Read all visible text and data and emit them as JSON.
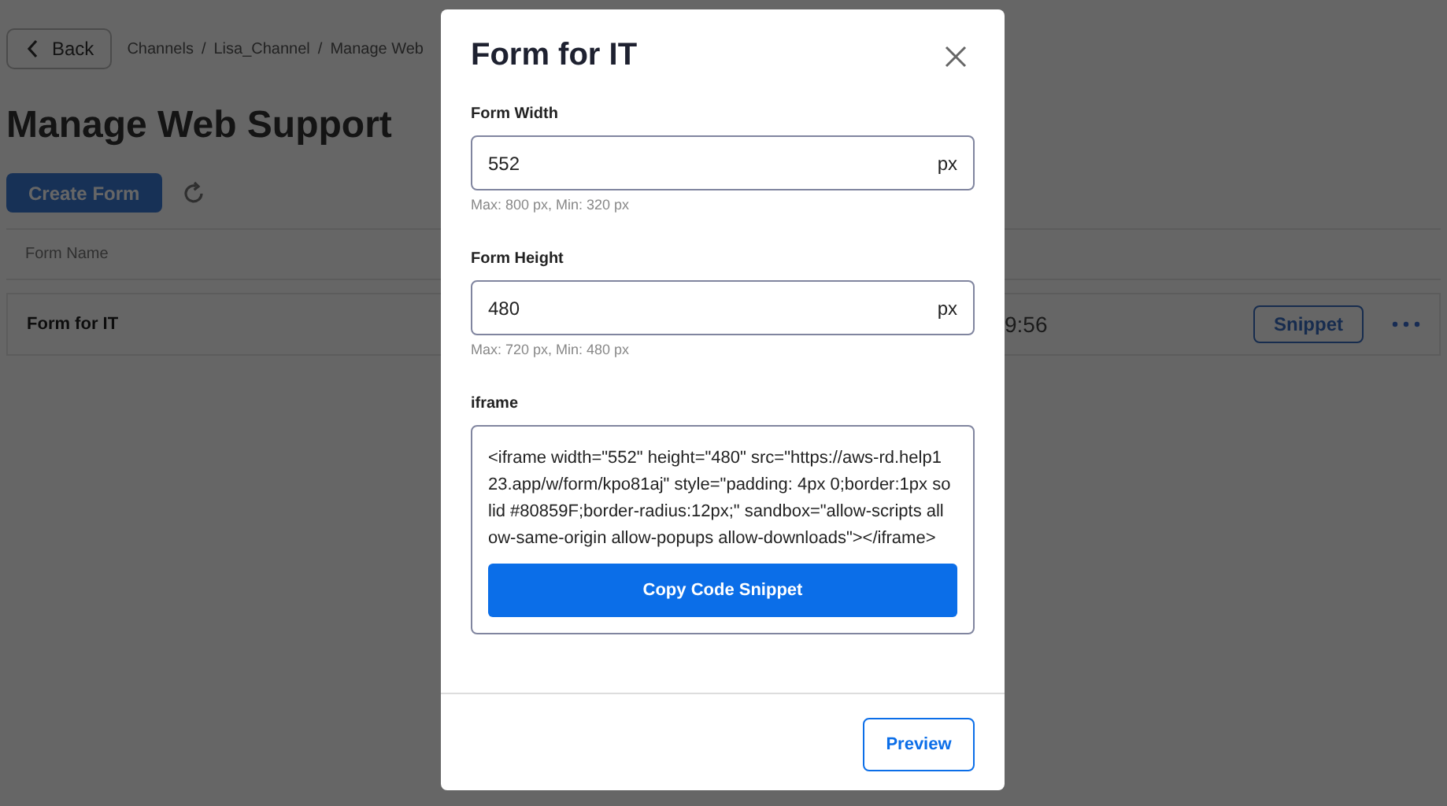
{
  "page": {
    "back_button": "Back",
    "breadcrumbs": [
      "Channels",
      "Lisa_Channel",
      "Manage Web"
    ],
    "breadcrumb_separator": "/",
    "title": "Manage Web Support",
    "create_button": "Create Form",
    "table": {
      "columns": [
        "Form Name"
      ],
      "rows": [
        {
          "name": "Form for IT",
          "time": "9:56",
          "action": "Snippet"
        }
      ]
    }
  },
  "modal": {
    "title": "Form for IT",
    "fields": [
      {
        "label": "Form Width",
        "value": "552",
        "unit": "px",
        "hint": "Max: 800 px, Min: 320 px"
      },
      {
        "label": "Form Height",
        "value": "480",
        "unit": "px",
        "hint": "Max: 720 px, Min: 480 px"
      }
    ],
    "iframe": {
      "label": "iframe",
      "code": "<iframe width=\"552\" height=\"480\" src=\"https://aws-rd.help123.app/w/form/kpo81aj\" style=\"padding: 4px 0;border:1px solid #80859F;border-radius:12px;\" sandbox=\"allow-scripts allow-same-origin allow-popups allow-downloads\"></iframe>",
      "copy_button": "Copy Code Snippet"
    },
    "preview_button": "Preview"
  }
}
